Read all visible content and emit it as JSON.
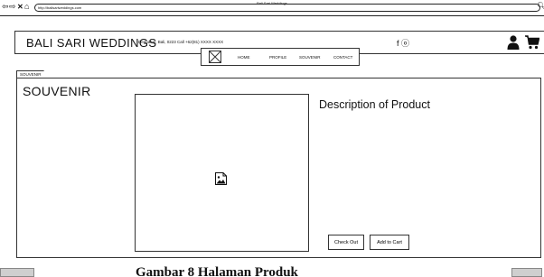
{
  "browser": {
    "title": "Bali Sari Weddings",
    "url": "http://balisariweddings.com"
  },
  "header": {
    "brand": "BALI SARI WEDDINGS",
    "contact": "Denpasar, Bali, 0223   Call +62(81) XXXX XXXX",
    "social": "f ⓞ"
  },
  "nav": {
    "items": [
      {
        "label": "HOME"
      },
      {
        "label": "PROFILE"
      },
      {
        "label": "SOUVENIR"
      },
      {
        "label": "CONTACT"
      }
    ]
  },
  "main": {
    "tab_label": "SOUVENIR",
    "section_title": "SOUVENIR",
    "description_title": "Description of Product",
    "checkout_label": "Check Out",
    "add_to_cart_label": "Add to Cart"
  },
  "caption": "Gambar 8 Halaman Produk"
}
